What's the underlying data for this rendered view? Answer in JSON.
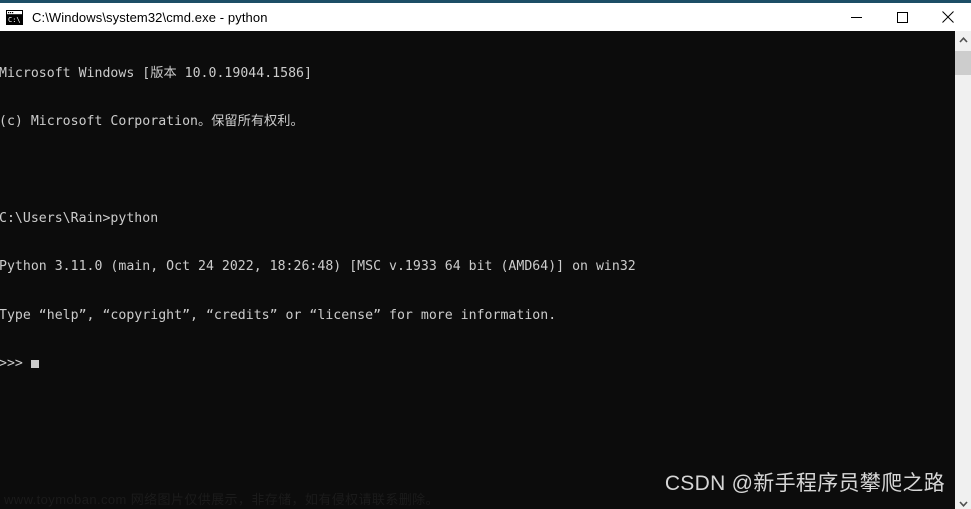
{
  "window": {
    "title": "C:\\Windows\\system32\\cmd.exe - python",
    "icon": "cmd-console-icon",
    "accent_color": "#1d4e66",
    "titlebar_bg": "#ffffff",
    "terminal_bg": "#0c0c0c",
    "terminal_fg": "#cccccc"
  },
  "window_controls": {
    "minimize": "minimize-icon",
    "maximize": "maximize-icon",
    "close": "close-icon"
  },
  "terminal": {
    "lines": [
      "Microsoft Windows [版本 10.0.19044.1586]",
      "(c) Microsoft Corporation。保留所有权利。",
      "",
      "C:\\Users\\Rain>python",
      "Python 3.11.0 (main, Oct 24 2022, 18:26:48) [MSC v.1933 64 bit (AMD64)] on win32",
      "Type “help”, “copyright”, “credits” or “license” for more information.",
      ">>>"
    ],
    "prompt": ">>>",
    "cursor_visible": true
  },
  "scrollbar": {
    "up_arrow": "chevron-up-icon",
    "down_arrow": "chevron-down-icon",
    "thumb_color": "#cdcdcd",
    "track_color": "#f0f0f0"
  },
  "watermarks": {
    "csdn": "CSDN @新手程序员攀爬之路",
    "bottom": "www.toymoban.com 网络图片仅供展示，非存储，如有侵权请联系删除。"
  }
}
